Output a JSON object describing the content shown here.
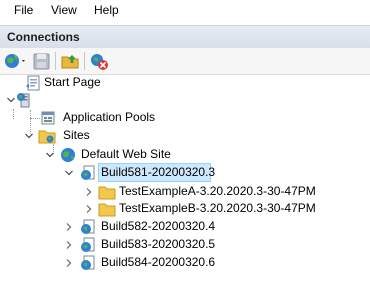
{
  "menubar": {
    "items": [
      {
        "label": "File"
      },
      {
        "label": "View"
      },
      {
        "label": "Help"
      }
    ]
  },
  "panel": {
    "title": "Connections"
  },
  "toolbar": {
    "buttons": [
      {
        "icon": "connect-globe-icon"
      },
      {
        "icon": "save-icon"
      },
      {
        "icon": "up-folder-icon"
      },
      {
        "icon": "disconnect-icon"
      }
    ]
  },
  "tree": {
    "start_page": "Start Page",
    "server": "",
    "app_pools": "Application Pools",
    "sites": "Sites",
    "default_site": "Default Web Site",
    "selected": "Build581-20200320.3",
    "children": [
      "TestExampleA-3.20.2020.3-30-47PM",
      "TestExampleB-3.20.2020.3-30-47PM"
    ],
    "siblings": [
      "Build582-20200320.4",
      "Build583-20200320.5",
      "Build584-20200320.6"
    ]
  },
  "colors": {
    "selection": "#cce8ff",
    "selection_border": "#99d1ff",
    "header_bg": "#dfe6ef",
    "folder": "#f3c84a"
  }
}
